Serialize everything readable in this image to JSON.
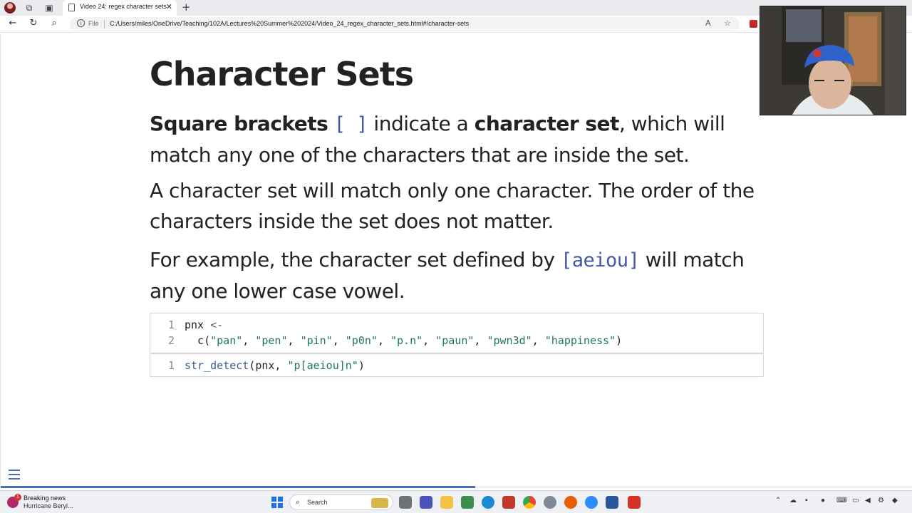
{
  "browser": {
    "tab_title": "Video 24: regex character sets",
    "tab_close": "✕",
    "new_tab": "+",
    "address_scheme_label": "File",
    "url": "C:/Users/miles/OneDrive/Teaching/102A/Lectures%20Summer%202024/Video_24_regex_character_sets.html#/character-sets",
    "nav_icons": [
      "back-icon",
      "refresh-icon",
      "search-icon"
    ],
    "right_icons": [
      "read-aloud-icon",
      "favorite-star-icon",
      "extension-icon"
    ]
  },
  "slide": {
    "title": "Character Sets",
    "p1": {
      "bold1": "Square brackets",
      "code": "[ ]",
      "text1": " indicate a ",
      "bold2": "character set",
      "text2": ", which will match any one of the characters that are inside the set."
    },
    "p2": "A character set will match only one character. The order of the characters inside the set does not matter.",
    "p3": {
      "text1": "For example, the character set defined by ",
      "code": "[aeiou]",
      "text2": " will match any one lower case vowel."
    },
    "code_block_1": [
      {
        "n": "1",
        "parts": [
          [
            "pnx ",
            ""
          ],
          [
            "<-",
            "op"
          ]
        ]
      },
      {
        "n": "2",
        "parts": [
          [
            "  c(",
            ""
          ],
          [
            "\"pan\"",
            "str"
          ],
          [
            ", ",
            ""
          ],
          [
            "\"pen\"",
            "str"
          ],
          [
            ", ",
            ""
          ],
          [
            "\"pin\"",
            "str"
          ],
          [
            ", ",
            ""
          ],
          [
            "\"p0n\"",
            "str"
          ],
          [
            ", ",
            ""
          ],
          [
            "\"p.n\"",
            "str"
          ],
          [
            ", ",
            ""
          ],
          [
            "\"paun\"",
            "str"
          ],
          [
            ", ",
            ""
          ],
          [
            "\"pwn3d\"",
            "str"
          ],
          [
            ", ",
            ""
          ],
          [
            "\"happiness\"",
            "str"
          ],
          [
            ")",
            ""
          ]
        ]
      }
    ],
    "code_block_2": [
      {
        "n": "1",
        "parts": [
          [
            "str_detect",
            "fn"
          ],
          [
            "(pnx, ",
            ""
          ],
          [
            "\"p[aeiou]n\"",
            "str"
          ],
          [
            ")",
            ""
          ]
        ]
      }
    ],
    "progress_fraction": 0.52,
    "menu_icon": "hamburger-menu-icon"
  },
  "taskbar": {
    "news_badge": "1",
    "news_title": "Breaking news",
    "news_subtitle": "Hurricane Beryl...",
    "search_placeholder": "Search",
    "apps": [
      "task-view-icon",
      "teams-icon",
      "file-explorer-icon",
      "notepad-icon",
      "edge-icon",
      "files-icon",
      "chrome-icon",
      "r-icon",
      "firefox-icon",
      "zoom-icon",
      "word-icon",
      "slides-app-icon"
    ],
    "accent_colors": {
      "windows": "#1a73e8",
      "slide_accent": "#4a6fc0",
      "code_string": "#20794d"
    }
  }
}
